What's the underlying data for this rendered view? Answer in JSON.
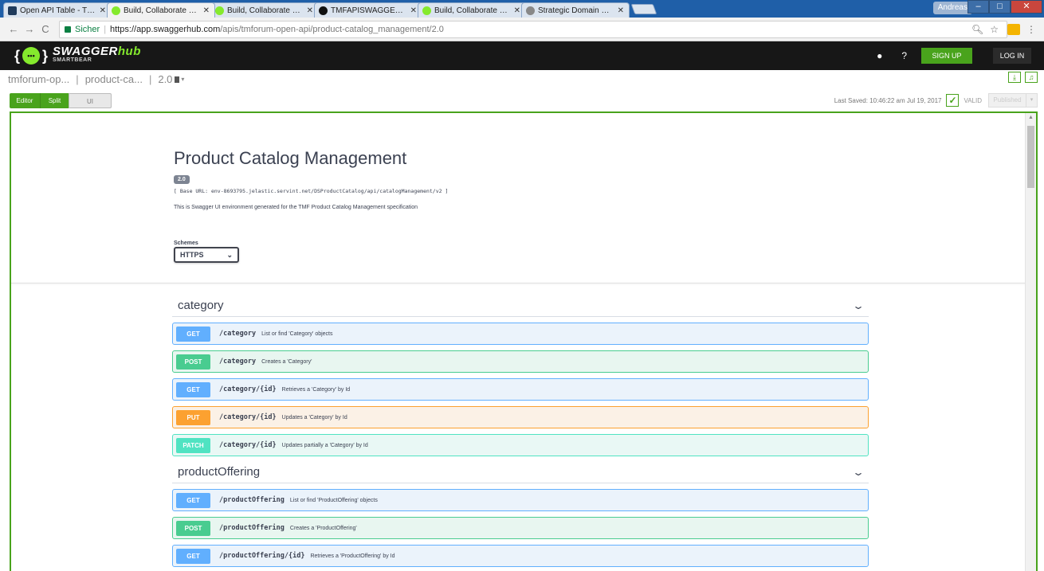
{
  "browser": {
    "tabs": [
      {
        "title": "Open API Table - TM Foru",
        "active": false,
        "favicon_color": "#1f3b5c"
      },
      {
        "title": "Build, Collaborate & Integ",
        "active": true,
        "favicon_color": "#85ea2d"
      },
      {
        "title": "Build, Collaborate & Integ",
        "active": false,
        "favicon_color": "#85ea2d"
      },
      {
        "title": "TMFAPISWAGGER/swagg",
        "active": false,
        "favicon_color": "#111111"
      },
      {
        "title": "Build, Collaborate & Integ",
        "active": false,
        "favicon_color": "#85ea2d"
      },
      {
        "title": "Strategic Domain Driven",
        "active": false,
        "favicon_color": "#888888"
      }
    ],
    "user": "Andreas",
    "secure_label": "Sicher",
    "url_host": "https://app.swaggerhub.com",
    "url_path": "/apis/tmforum-open-api/product-catalog_management/2.0"
  },
  "hub": {
    "logo_main_a": "SWAGGER",
    "logo_main_b": "hub",
    "logo_sub": "SMARTBEAR",
    "signup": "SIGN UP",
    "login": "LOG IN"
  },
  "breadcrumb": {
    "owner": "tmforum-op...",
    "api": "product-ca...",
    "version": "2.0"
  },
  "view_toggle": {
    "editor": "Editor",
    "split": "Split",
    "ui": "UI"
  },
  "status": {
    "last_saved": "Last Saved: 10:46:22 am Jul 19, 2017",
    "valid": "VALID",
    "published": "Published"
  },
  "info": {
    "title": "Product Catalog Management",
    "version": "2.0",
    "base_url": "[ Base URL: env-8693795.jelastic.servint.net/DSProductCatalog/api/catalogManagement/v2 ]",
    "description": "This is Swagger UI environment generated for the TMF Product Catalog Management specification",
    "schemes_label": "Schemes",
    "scheme_selected": "HTTPS"
  },
  "groups": [
    {
      "name": "category",
      "operations": [
        {
          "method": "GET",
          "path": "/category",
          "summary": "List or find 'Category' objects"
        },
        {
          "method": "POST",
          "path": "/category",
          "summary": "Creates a 'Category'"
        },
        {
          "method": "GET",
          "path": "/category/{id}",
          "summary": "Retrieves a 'Category' by Id"
        },
        {
          "method": "PUT",
          "path": "/category/{id}",
          "summary": "Updates a 'Category' by Id"
        },
        {
          "method": "PATCH",
          "path": "/category/{id}",
          "summary": "Updates partially a 'Category' by Id"
        }
      ]
    },
    {
      "name": "productOffering",
      "operations": [
        {
          "method": "GET",
          "path": "/productOffering",
          "summary": "List or find 'ProductOffering' objects"
        },
        {
          "method": "POST",
          "path": "/productOffering",
          "summary": "Creates a 'ProductOffering'"
        },
        {
          "method": "GET",
          "path": "/productOffering/{id}",
          "summary": "Retrieves a 'ProductOffering' by Id"
        }
      ]
    }
  ],
  "colors": {
    "get": "#61affe",
    "post": "#49cc90",
    "put": "#fca130",
    "patch": "#50e3c2",
    "brand_green": "#49a31c",
    "header_bg": "#171717"
  }
}
